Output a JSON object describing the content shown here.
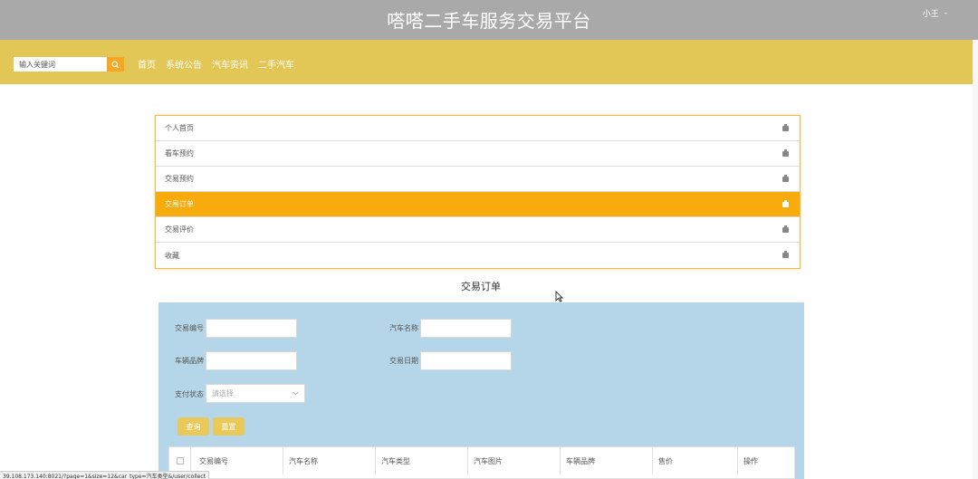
{
  "header": {
    "site_title": "嗒嗒二手车服务交易平台",
    "user_name": "小王",
    "user_menu_arrow": "-"
  },
  "nav": {
    "search_placeholder": "输入关键词",
    "links": [
      "首页",
      "系统公告",
      "汽车资讯",
      "二手汽车"
    ]
  },
  "sidebar_menu": {
    "items": [
      "个人首页",
      "看车预约",
      "交易预约",
      "交易订单",
      "交易评价",
      "收藏"
    ],
    "active_index": 3
  },
  "section": {
    "title": "交易订单"
  },
  "filters": {
    "order_no_label": "交易编号",
    "car_name_label": "汽车名称",
    "brand_label": "车辆品牌",
    "date_label": "交易日期",
    "pay_status_label": "支付状态",
    "pay_status_placeholder": "请选择",
    "query_button": "查询",
    "reset_button": "重置"
  },
  "table": {
    "headers": [
      "交易编号",
      "汽车名称",
      "汽车类型",
      "汽车图片",
      "车辆品牌",
      "售价",
      "操作"
    ]
  },
  "statusbar": {
    "url": "39.108.173.140:8021/?page=1&size=12&car_type=汽车类型&/user/collect"
  },
  "colors": {
    "topbar": "#a9a9a9",
    "navbar": "#e3c756",
    "active_menu": "#f8ab0c",
    "filter_panel": "#b4d6e8",
    "button": "#e9c95a"
  }
}
